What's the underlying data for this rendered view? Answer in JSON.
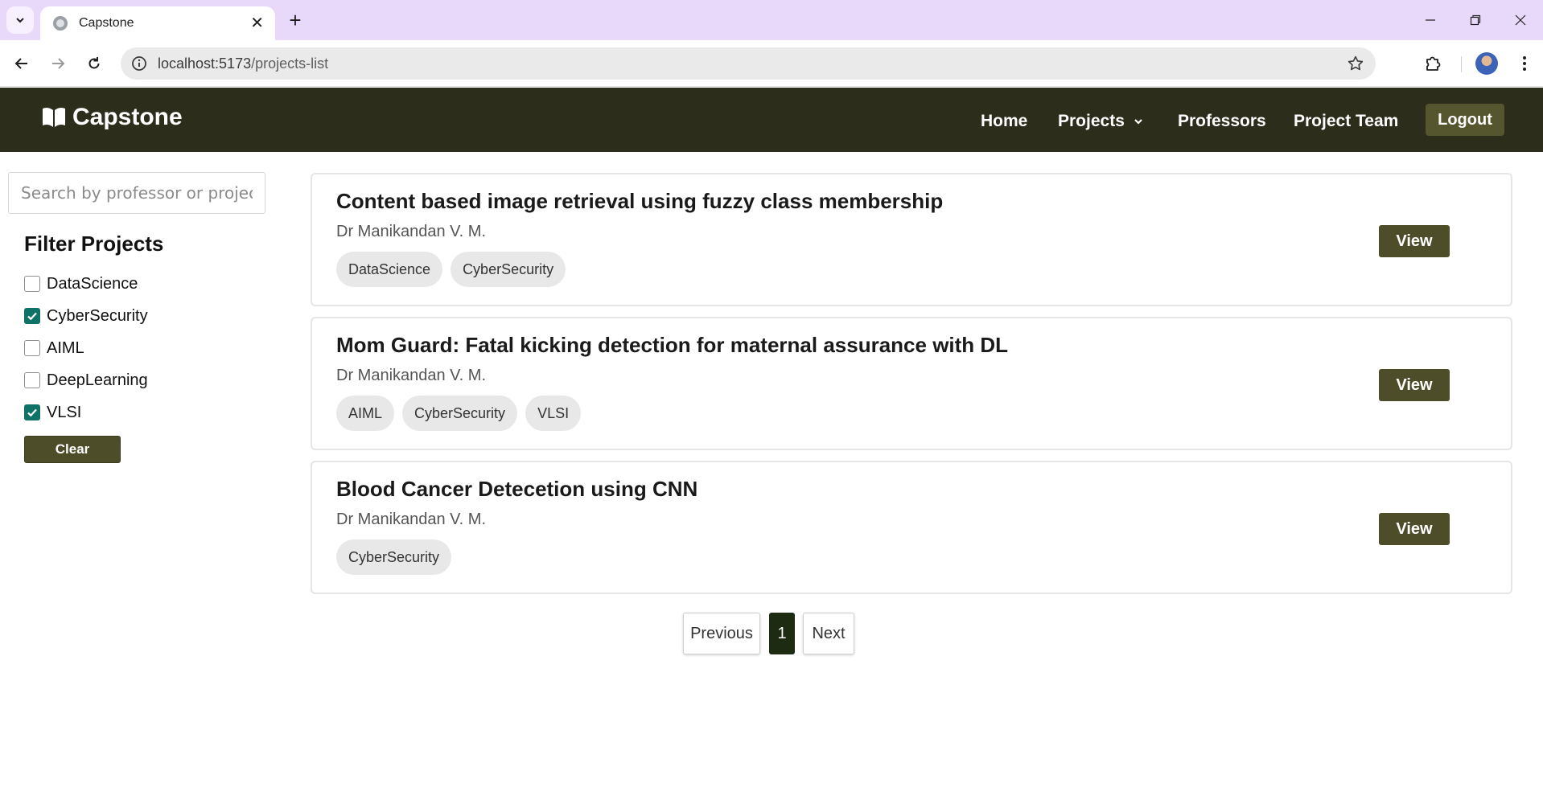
{
  "browser": {
    "tab_title": "Capstone",
    "url_host": "localhost:5173",
    "url_path": "/projects-list"
  },
  "header": {
    "brand": "Capstone",
    "nav": {
      "home": "Home",
      "projects": "Projects",
      "professors": "Professors",
      "team": "Project Team"
    },
    "logout": "Logout"
  },
  "sidebar": {
    "search_placeholder": "Search by professor or project",
    "search_value": "",
    "filter_title": "Filter Projects",
    "filters": [
      {
        "label": "DataScience",
        "checked": false
      },
      {
        "label": "CyberSecurity",
        "checked": true
      },
      {
        "label": "AIML",
        "checked": false
      },
      {
        "label": "DeepLearning",
        "checked": false
      },
      {
        "label": "VLSI",
        "checked": true
      }
    ],
    "clear_label": "Clear"
  },
  "projects": [
    {
      "title": "Content based image retrieval using fuzzy class membership",
      "professor": "Dr Manikandan V. M.",
      "tags": [
        "DataScience",
        "CyberSecurity"
      ],
      "view_label": "View"
    },
    {
      "title": "Mom Guard: Fatal kicking detection for maternal assurance with DL",
      "professor": "Dr Manikandan V. M.",
      "tags": [
        "AIML",
        "CyberSecurity",
        "VLSI"
      ],
      "view_label": "View"
    },
    {
      "title": "Blood Cancer Detecetion using CNN",
      "professor": "Dr Manikandan V. M.",
      "tags": [
        "CyberSecurity"
      ],
      "view_label": "View"
    }
  ],
  "pagination": {
    "previous": "Previous",
    "current": "1",
    "next": "Next"
  },
  "colors": {
    "header_bg": "#2d2d1c",
    "button_olive": "#4d4d2a",
    "checkbox_checked": "#0e7268",
    "tabbar_bg": "#e8d9fb"
  },
  "icons": {
    "brand": "book-open-icon",
    "tab_favicon": "globe-icon",
    "projects_dropdown": "chevron-down-icon",
    "omnibox_info": "info-icon",
    "bookmark": "star-icon",
    "extensions": "puzzle-icon"
  }
}
